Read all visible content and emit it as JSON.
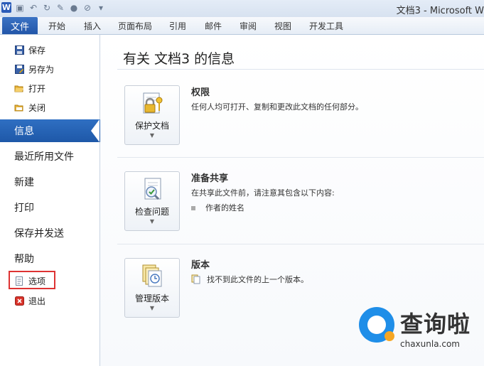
{
  "window": {
    "title": "文档3 - Microsoft W"
  },
  "qat": {
    "logo": "W"
  },
  "ribbon": {
    "file_tab": "文件",
    "tabs": [
      "开始",
      "插入",
      "页面布局",
      "引用",
      "邮件",
      "审阅",
      "视图",
      "开发工具"
    ]
  },
  "sidebar": {
    "save": "保存",
    "save_as": "另存为",
    "open": "打开",
    "close": "关闭",
    "info": "信息",
    "recent": "最近所用文件",
    "new": "新建",
    "print": "打印",
    "save_send": "保存并发送",
    "help": "帮助",
    "options": "选项",
    "exit": "退出"
  },
  "info": {
    "title": "有关 文档3 的信息",
    "permissions": {
      "button": "保护文档",
      "title": "权限",
      "desc": "任何人均可打开、复制和更改此文档的任何部分。"
    },
    "prepare": {
      "button": "检查问题",
      "title": "准备共享",
      "desc": "在共享此文件前，请注意其包含以下内容:",
      "bullet": "作者的姓名"
    },
    "versions": {
      "button": "管理版本",
      "title": "版本",
      "desc": "找不到此文件的上一个版本。"
    }
  },
  "watermark": {
    "brand": "查询啦",
    "url": "chaxunla.com"
  },
  "colors": {
    "accent": "#2256a9",
    "highlight": "#d33333",
    "brand_blue": "#1f8ee8",
    "brand_orange": "#f5a623"
  }
}
